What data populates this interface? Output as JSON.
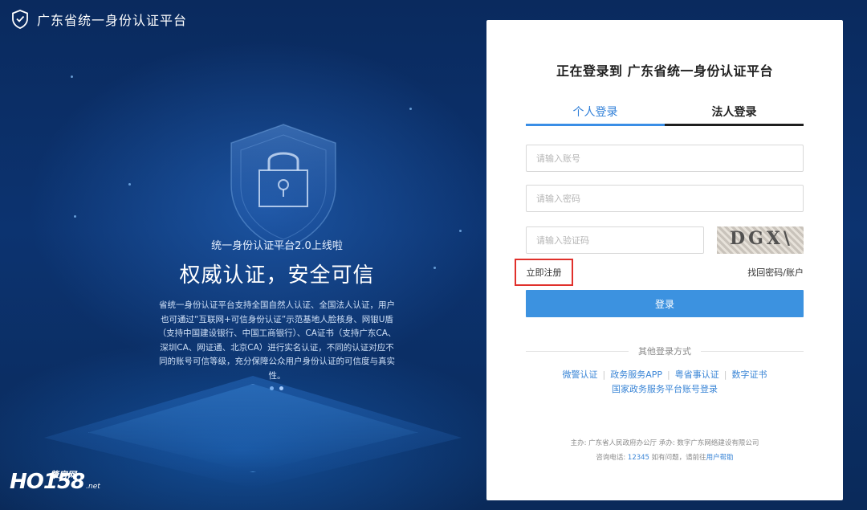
{
  "header": {
    "title": "广东省统一身份认证平台"
  },
  "hero": {
    "subtitle": "统一身份认证平台2.0上线啦",
    "title": "权威认证，安全可信",
    "description": "省统一身份认证平台支持全国自然人认证、全国法人认证，用户也可通过“互联网+可信身份认证”示范基地人脸核身、网银U盾（支持中国建设银行、中国工商银行）、CA证书（支持广东CA、深圳CA、网证通、北京CA）进行实名认证，不同的认证对应不同的账号可信等级，充分保障公众用户身份认证的可信度与真实性。"
  },
  "login": {
    "title": "正在登录到 广东省统一身份认证平台",
    "tabs": [
      {
        "label": "个人登录",
        "active": true
      },
      {
        "label": "法人登录",
        "active": false
      }
    ],
    "account_placeholder": "请输入账号",
    "password_placeholder": "请输入密码",
    "captcha_placeholder": "请输入验证码",
    "captcha_text": "DGX\\",
    "register_label": "立即注册",
    "forgot_label": "找回密码/账户",
    "submit_label": "登录",
    "other_title": "其他登录方式",
    "other_methods": [
      "微警认证",
      "政务服务APP",
      "粤省事认证",
      "数字证书"
    ],
    "other_method_extra": "国家政务服务平台账号登录",
    "footer_line1": "主办: 广东省人民政府办公厅   承办: 数字广东网络建设有限公司",
    "footer_prefix": "咨询电话: ",
    "footer_phone": "12345",
    "footer_mid": "  如有问题，请前往",
    "footer_help": "用户帮助"
  },
  "watermark": {
    "main": "HO158",
    "cn": "肇房网",
    "suffix": ".net"
  },
  "colors": {
    "accent": "#3c92e0",
    "highlight": "#e0302b",
    "background": "#0b2b5c"
  }
}
